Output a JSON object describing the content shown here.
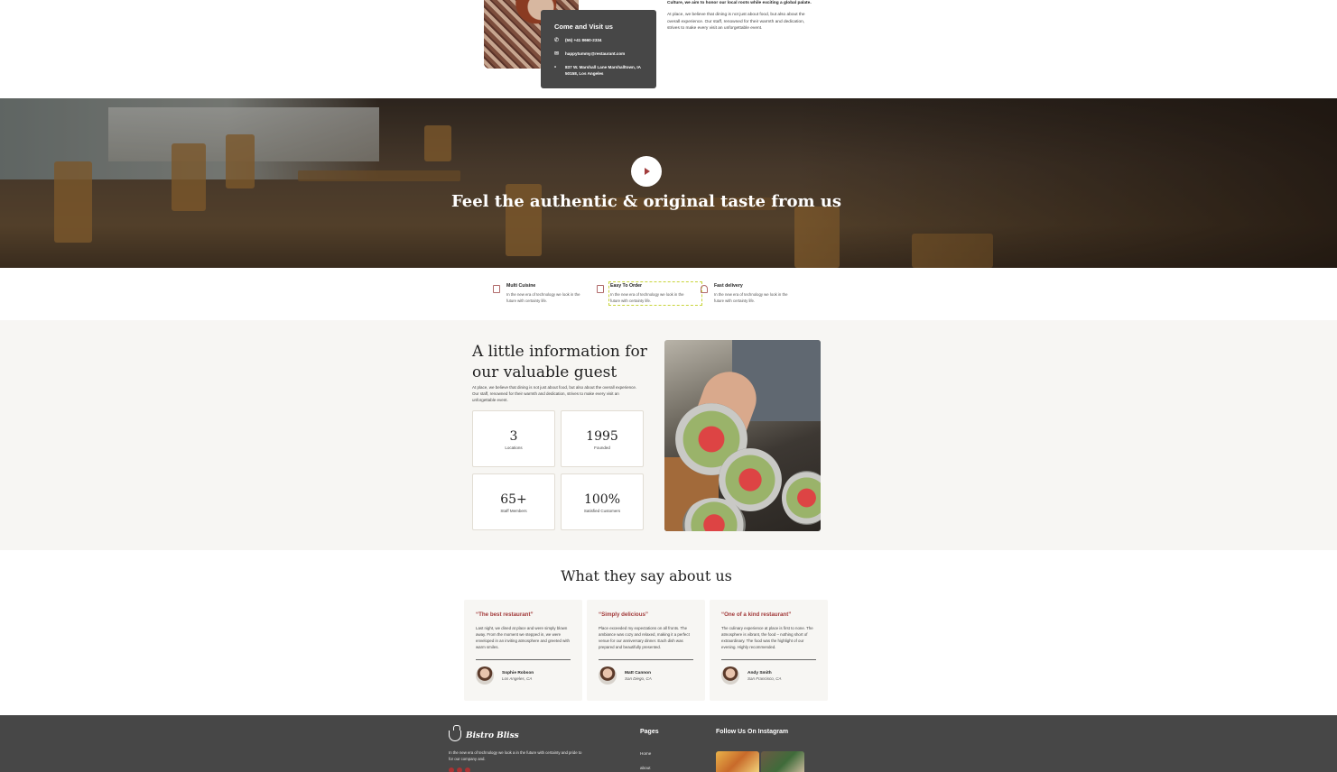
{
  "contact": {
    "title": "Come and Visit us",
    "phone": "(55) +41 8660-2334",
    "email": "happytummy@restaurant.com",
    "address": "837 W. Marshall Lane Marshalltown, IA 50158, Los Angeles"
  },
  "about_snippet": {
    "lead": "Culture, we aim to honor our local roots while exciting a global palate.",
    "body": "At place, we believe that dining is not just about food, but also about the overall experience. Our staff, renowned for their warmth and dedication, strives to make every visit an unforgettable event."
  },
  "hero": {
    "title": "Feel the authentic & original taste from us"
  },
  "features": [
    {
      "title": "Multi Cuisine",
      "text": "In the new era of technology we look in the future with certainty life."
    },
    {
      "title": "Easy To Order",
      "text": "In the new era of technology we look in the future with certainty life."
    },
    {
      "title": "Fast delivery",
      "text": "In the new era of technology we look in the future with certainty life."
    }
  ],
  "info": {
    "title": "A little information for our valuable guest",
    "text": "At place, we believe that dining is not just about food, but also about the overall experience. Our staff, renowned for their warmth and dedication, strives to make every visit an unforgettable event.",
    "stats": [
      {
        "value": "3",
        "label": "Locations"
      },
      {
        "value": "1995",
        "label": "Founded"
      },
      {
        "value": "65+",
        "label": "Staff Members"
      },
      {
        "value": "100%",
        "label": "Satisfied Customers"
      }
    ]
  },
  "testimonials": {
    "title": "What they say about us",
    "items": [
      {
        "quote": "“The best restaurant”",
        "text": "Last night, we dined at place and were simply blown away. From the moment we stepped in, we were enveloped in an inviting atmosphere and greeted with warm smiles.",
        "name": "Sophie Robson",
        "location": "Los Angeles, CA"
      },
      {
        "quote": "“Simply delicious”",
        "text": "Place exceeded my expectations on all fronts. The ambiance was cozy and relaxed, making it a perfect venue for our anniversary dinner. Each dish was prepared and beautifully presented.",
        "name": "Matt Cannon",
        "location": "San Diego, CA"
      },
      {
        "quote": "“One of a kind restaurant”",
        "text": "The culinary experience at place is first to none. The atmosphere is vibrant, the food – nothing short of extraordinary. The food was the highlight of our evening. Highly recommended.",
        "name": "Andy Smith",
        "location": "San Francisco, CA"
      }
    ]
  },
  "footer": {
    "brand": "Bistro Bliss",
    "text": "In the new era of technology we look a in the future with certainty and pride to for our company and.",
    "pages_title": "Pages",
    "pages": [
      "Home",
      "about"
    ],
    "instagram_title": "Follow Us On Instagram"
  }
}
